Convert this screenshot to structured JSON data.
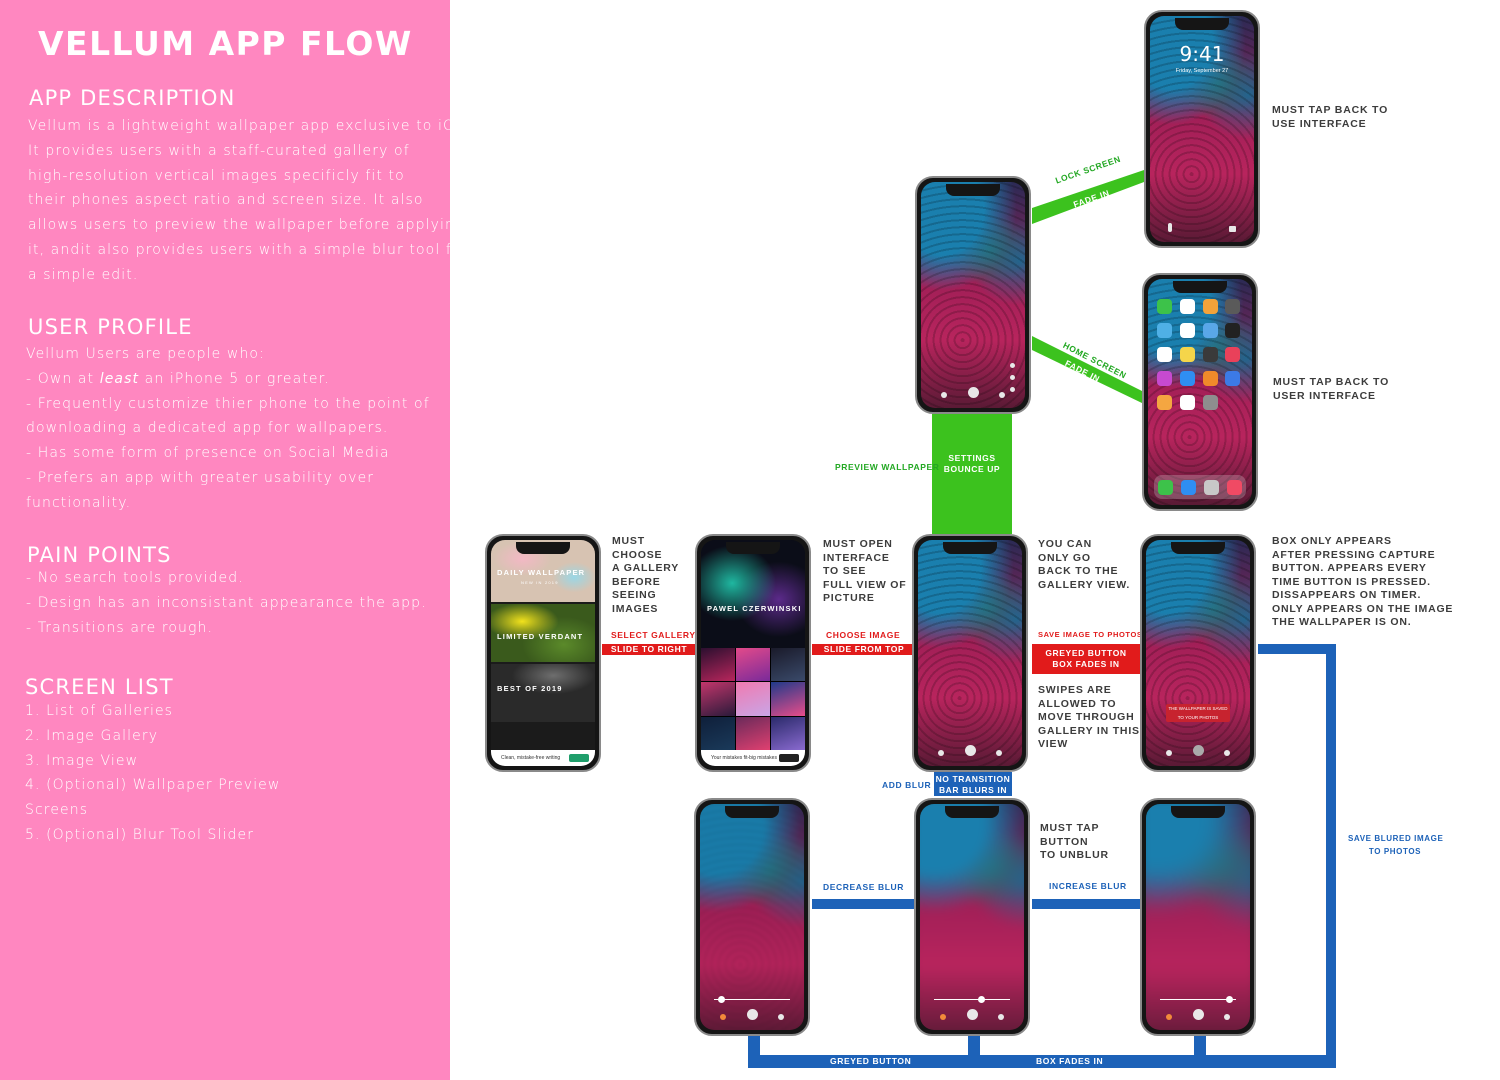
{
  "sidebar": {
    "title": "VELLUM APP FLOW",
    "sections": [
      {
        "heading": "APP DESCRIPTION",
        "lines": [
          "Vellum is a lightweight wallpaper app exclusive to iOS.",
          "It provides users with a staff-curated gallery of",
          "high-resolution vertical images specificly fit to",
          "their phones aspect ratio and screen size. It also",
          "allows users to preview the wallpaper before applying",
          "it, andit also provides users with a simple blur tool for",
          "a simple edit."
        ]
      },
      {
        "heading": "USER PROFILE",
        "lines": [
          "Vellum Users are people who:",
          "- Own at least an iPhone 5 or greater.",
          "- Frequently customize thier phone to the point of",
          "downloading a dedicated app for wallpapers.",
          "- Has some form of presence on Social Media",
          "- Prefers an app with greater usability over",
          " functionality."
        ]
      },
      {
        "heading": "PAIN POINTS",
        "lines": [
          "- No search tools provided.",
          "- Design has an inconsistant appearance the app.",
          "- Transitions are rough."
        ]
      },
      {
        "heading": "SCREEN LIST",
        "lines": [
          "1. List of Galleries",
          "2. Image Gallery",
          "3. Image View",
          "4. (Optional) Wallpaper Preview",
          "Screens",
          "5. (Optional) Blur Tool Slider"
        ]
      }
    ]
  },
  "phones": {
    "lock_time": "9:41",
    "lock_date": "Friday, September 27",
    "galleries": [
      "DAILY WALLPAPER",
      "LIMITED VERDANT",
      "BEST OF 2019"
    ],
    "gallery_subtitle": "NEW IN 2019",
    "gallery_ad": "Clean, mistake-free writing",
    "artist_name": "PAWEL CZERWINSKI",
    "gallery_ad2": "Your mistakes fit-big mistakes",
    "toast_text": "THE WALLPAPER IS SAVED TO YOUR PHOTOS"
  },
  "connectors": {
    "lock_screen_1": "LOCK SCREEN",
    "lock_screen_2": "FADE IN",
    "home_screen_1": "HOME SCREEN",
    "home_screen_2": "FADE IN",
    "settings_1": "SETTINGS",
    "settings_2": "BOUNCE UP",
    "preview_wallpaper": "PREVIEW WALLPAPER",
    "select_gallery": "SELECT GALLERY",
    "slide_right": "SLIDE TO RIGHT",
    "choose_image": "CHOOSE IMAGE",
    "slide_top": "SLIDE FROM TOP",
    "save_image": "SAVE IMAGE TO PHOTOS",
    "greyed_box_1": "GREYED BUTTON",
    "greyed_box_2": "BOX FADES IN",
    "no_transition_1": "NO TRANSITION",
    "no_transition_2": "BAR BLURS IN",
    "add_blur": "ADD BLUR",
    "decrease_blur": "DECREASE BLUR",
    "increase_blur": "INCREASE BLUR",
    "save_blured_1": "SAVE BLURED IMAGE",
    "save_blured_2": "TO PHOTOS",
    "bottom_greyed": "GREYED BUTTON",
    "bottom_box": "BOX FADES IN"
  },
  "notes": {
    "must_tap_back_1": [
      "MUST TAP BACK TO",
      "USE INTERFACE"
    ],
    "must_tap_back_2": [
      "MUST TAP BACK TO",
      "USER INTERFACE"
    ],
    "must_choose": [
      "MUST",
      "CHOOSE",
      "A GALLERY",
      "BEFORE",
      "SEEING",
      "IMAGES"
    ],
    "must_open": [
      "MUST OPEN",
      "INTERFACE",
      "TO SEE",
      "FULL VIEW OF",
      "PICTURE"
    ],
    "only_go_back": [
      "YOU CAN",
      "ONLY GO",
      "BACK TO THE",
      "GALLERY VIEW."
    ],
    "box_only": [
      "BOX ONLY APPEARS",
      "AFTER PRESSING CAPTURE",
      "BUTTON. APPEARS EVERY",
      "TIME BUTTON IS PRESSED.",
      "DISSAPPEARS ON TIMER.",
      "ONLY APPEARS ON THE IMAGE",
      "THE WALLPAPER IS ON."
    ],
    "swipes": [
      "SWIPES ARE",
      "ALLOWED TO",
      "MOVE THROUGH",
      "GALLERY IN THIS",
      "VIEW"
    ],
    "tap_unblur": [
      "MUST TAP",
      "BUTTON",
      "TO UNBLUR"
    ]
  },
  "colors": {
    "sidebar": "#ff87c0",
    "green": "#3cc21e",
    "red": "#e11b1b",
    "blue": "#1d62b8"
  }
}
